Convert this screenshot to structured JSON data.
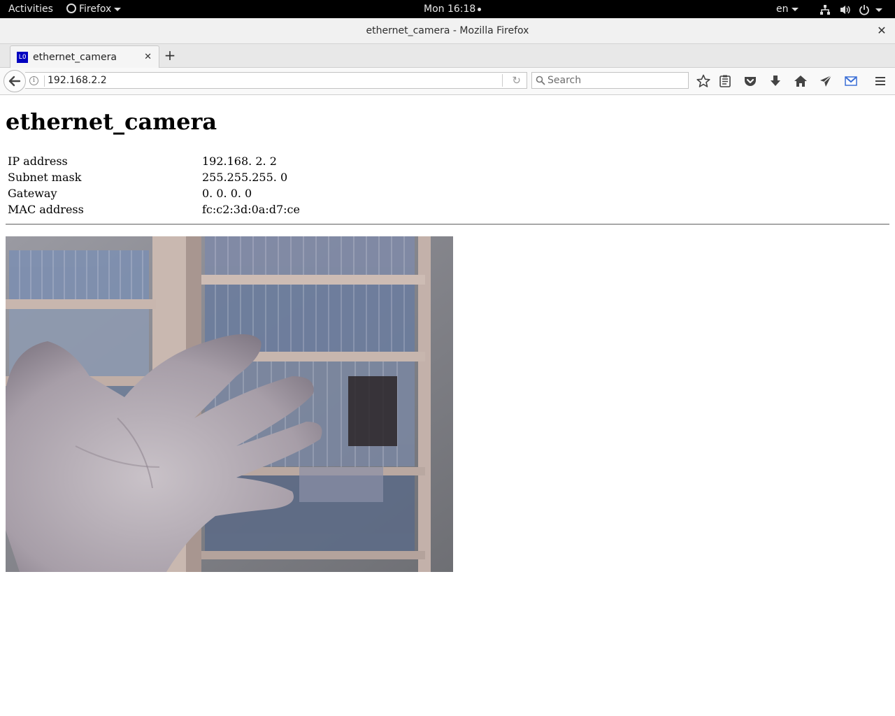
{
  "topbar": {
    "activities": "Activities",
    "app_menu": "Firefox",
    "clock": "Mon 16:18",
    "language": "en"
  },
  "window": {
    "title": "ethernet_camera - Mozilla Firefox"
  },
  "tabs": [
    {
      "favicon_text": "LO",
      "label": "ethernet_camera"
    }
  ],
  "navbar": {
    "url": "192.168.2.2",
    "search_placeholder": "Search"
  },
  "page": {
    "heading": "ethernet_camera",
    "network_info": [
      {
        "key": "IP address",
        "value": "192.168. 2. 2"
      },
      {
        "key": "Subnet mask",
        "value": "255.255.255. 0"
      },
      {
        "key": "Gateway",
        "value": "0. 0. 0. 0"
      },
      {
        "key": "MAC address",
        "value": "fc:c2:3d:0a:d7:ce"
      }
    ]
  },
  "icons": {
    "toolbar": [
      "bookmark-star-icon",
      "reading-list-icon",
      "pocket-icon",
      "download-icon",
      "home-icon",
      "send-icon",
      "gmail-icon",
      "hamburger-menu-icon"
    ],
    "system": [
      "network-icon",
      "volume-icon",
      "power-icon"
    ]
  },
  "colors": {
    "topbar_bg": "#000000",
    "favicon_bg": "#0000c0",
    "gmail_accent": "#3b6fd6"
  }
}
